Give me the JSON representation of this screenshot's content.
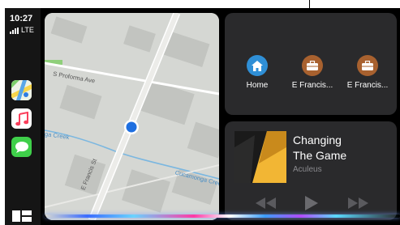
{
  "status": {
    "time": "10:27",
    "network": "LTE"
  },
  "dock": {
    "apps": [
      "maps-icon",
      "music-icon",
      "messages-icon"
    ],
    "dashboard": "dashboard-icon"
  },
  "map": {
    "streets": [
      "S Proforma Ave",
      "E Francis St",
      "Cucamonga Creek"
    ],
    "creek_short": "ga Creek"
  },
  "destinations": [
    {
      "label": "Home",
      "icon": "house-icon",
      "color": "#2f8fd6"
    },
    {
      "label": "E Francis...",
      "icon": "briefcase-icon",
      "color": "#a8612f"
    },
    {
      "label": "E Francis...",
      "icon": "briefcase-icon",
      "color": "#a8612f"
    }
  ],
  "now_playing": {
    "title_line1": "Changing",
    "title_line2": "The Game",
    "artist": "Aculeus"
  },
  "colors": {
    "background": "#000000",
    "panel": "#2a2a2c",
    "map": "#d2d4d0"
  }
}
